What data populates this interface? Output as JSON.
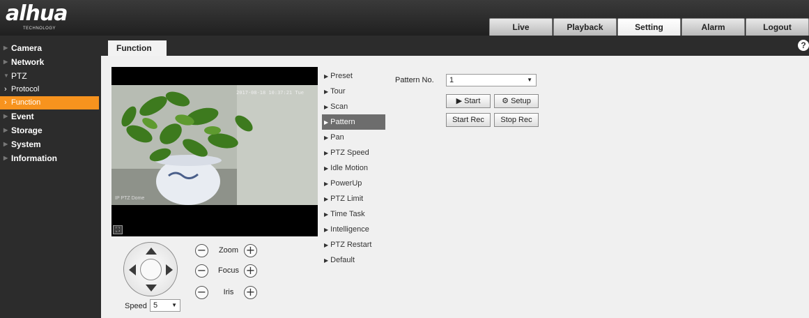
{
  "brand": {
    "logo": "alhua",
    "logo_sub": "TECHNOLOGY"
  },
  "top_nav": [
    {
      "label": "Live"
    },
    {
      "label": "Playback"
    },
    {
      "label": "Setting",
      "active": true
    },
    {
      "label": "Alarm"
    },
    {
      "label": "Logout"
    }
  ],
  "sidebar": {
    "items": [
      {
        "label": "Camera"
      },
      {
        "label": "Network"
      },
      {
        "label": "PTZ"
      },
      {
        "label": "Protocol"
      },
      {
        "label": "Function",
        "active": true
      },
      {
        "label": "Event"
      },
      {
        "label": "Storage"
      },
      {
        "label": "System"
      },
      {
        "label": "Information"
      }
    ]
  },
  "page": {
    "tab": "Function",
    "help": "?"
  },
  "video": {
    "timestamp": "2017-08-18 10:37:21 Tue",
    "camera_name": "IP PTZ Dome"
  },
  "ptz": {
    "zoom": "Zoom",
    "focus": "Focus",
    "iris": "Iris",
    "speed_label": "Speed",
    "speed_value": "5",
    "minus": "−",
    "plus": "+"
  },
  "menu": [
    {
      "label": "Preset"
    },
    {
      "label": "Tour"
    },
    {
      "label": "Scan"
    },
    {
      "label": "Pattern",
      "active": true
    },
    {
      "label": "Pan"
    },
    {
      "label": "PTZ Speed"
    },
    {
      "label": "Idle Motion"
    },
    {
      "label": "PowerUp"
    },
    {
      "label": "PTZ Limit"
    },
    {
      "label": "Time Task"
    },
    {
      "label": "Intelligence"
    },
    {
      "label": "PTZ Restart"
    },
    {
      "label": "Default"
    }
  ],
  "pattern": {
    "label": "Pattern No.",
    "value": "1",
    "start": "▶ Start",
    "setup": "⚙ Setup",
    "start_rec": "Start Rec",
    "stop_rec": "Stop Rec"
  },
  "colors": {
    "accent": "#f7931e",
    "menu_active": "#6d6d6d",
    "dark": "#2c2c2c"
  }
}
